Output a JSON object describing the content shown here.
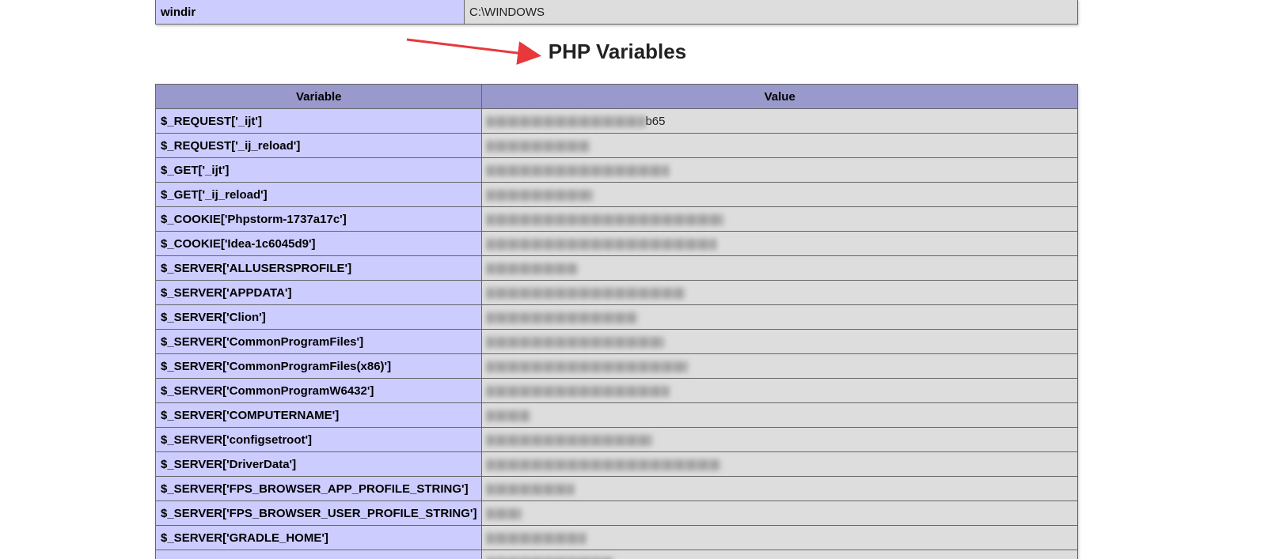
{
  "top_table": {
    "rows": [
      {
        "variable": "windir",
        "value": "C:\\WINDOWS"
      }
    ]
  },
  "heading": "PHP Variables",
  "annotation": {
    "arrow_color": "#e8383b"
  },
  "variables_table": {
    "headers": {
      "variable": "Variable",
      "value": "Value"
    },
    "rows": [
      {
        "variable": "$_REQUEST['_ijt']",
        "value": "b65"
      },
      {
        "variable": "$_REQUEST['_ij_reload']",
        "value": ""
      },
      {
        "variable": "$_GET['_ijt']",
        "value": ""
      },
      {
        "variable": "$_GET['_ij_reload']",
        "value": ""
      },
      {
        "variable": "$_COOKIE['Phpstorm-1737a17c']",
        "value": ""
      },
      {
        "variable": "$_COOKIE['Idea-1c6045d9']",
        "value": ""
      },
      {
        "variable": "$_SERVER['ALLUSERSPROFILE']",
        "value": ""
      },
      {
        "variable": "$_SERVER['APPDATA']",
        "value": ""
      },
      {
        "variable": "$_SERVER['Clion']",
        "value": ""
      },
      {
        "variable": "$_SERVER['CommonProgramFiles']",
        "value": ""
      },
      {
        "variable": "$_SERVER['CommonProgramFiles(x86)']",
        "value": ""
      },
      {
        "variable": "$_SERVER['CommonProgramW6432']",
        "value": ""
      },
      {
        "variable": "$_SERVER['COMPUTERNAME']",
        "value": ""
      },
      {
        "variable": "$_SERVER['configsetroot']",
        "value": ""
      },
      {
        "variable": "$_SERVER['DriverData']",
        "value": ""
      },
      {
        "variable": "$_SERVER['FPS_BROWSER_APP_PROFILE_STRING']",
        "value": ""
      },
      {
        "variable": "$_SERVER['FPS_BROWSER_USER_PROFILE_STRING']",
        "value": ""
      },
      {
        "variable": "$_SERVER['GRADLE_HOME']",
        "value": ""
      },
      {
        "variable": "",
        "value": ""
      }
    ]
  }
}
